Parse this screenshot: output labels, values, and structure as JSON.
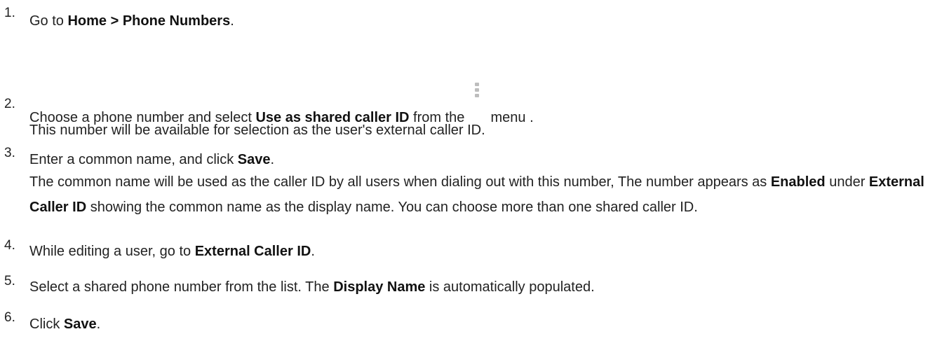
{
  "steps": [
    {
      "number": "1.",
      "pre": "Go to ",
      "bold": "Home > Phone Numbers",
      "post": "."
    },
    {
      "number": "2.",
      "pre": "Choose a phone number and select ",
      "bold": "Use as shared caller ID",
      "mid": " from the ",
      "icon": "kebab-menu-icon",
      "post": " menu .",
      "note": "This number will be available for selection as the user's external caller ID."
    },
    {
      "number": "3.",
      "pre": "Enter a common name, and click ",
      "bold": "Save",
      "post": ".",
      "note_pre": "The common name will be used as the caller ID by all users when dialing out with this number, The number appears as ",
      "note_bold1": "Enabled",
      "note_mid": " under ",
      "note_bold2": "External Caller ID",
      "note_post": " showing the common name as the display name. You can choose more than one shared caller ID."
    },
    {
      "number": "4.",
      "pre": "While editing a user, go to ",
      "bold": "External Caller ID",
      "post": "."
    },
    {
      "number": "5.",
      "pre": "Select a shared phone number from the list. The ",
      "bold": "Display Name",
      "post": " is automatically populated."
    },
    {
      "number": "6.",
      "pre": "Click ",
      "bold": "Save",
      "post": "."
    }
  ]
}
